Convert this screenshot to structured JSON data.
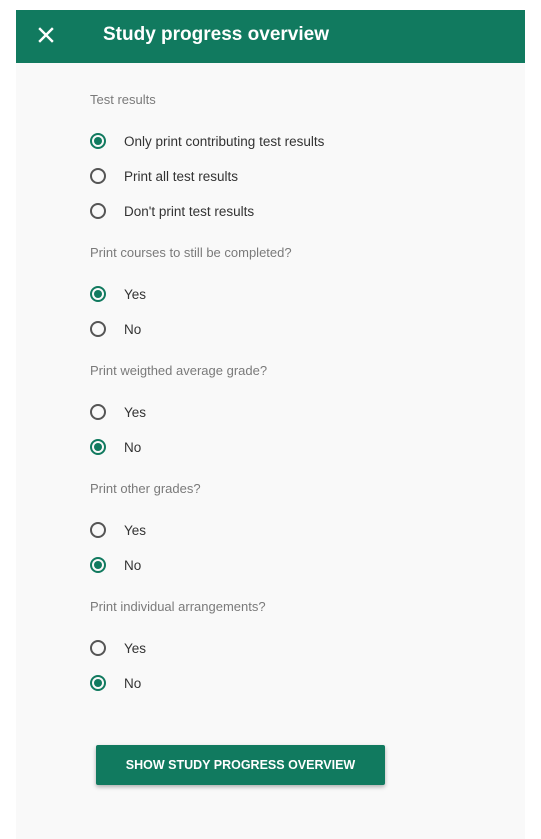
{
  "header": {
    "title": "Study progress overview",
    "close_icon": "close-icon"
  },
  "colors": {
    "primary": "#117a5f",
    "panel_background": "#f9f9f9",
    "label_text": "#7a7a7a"
  },
  "groups": [
    {
      "label": "Test results",
      "options": [
        {
          "label": "Only print contributing test results",
          "checked": true
        },
        {
          "label": "Print all test results",
          "checked": false
        },
        {
          "label": "Don't print test results",
          "checked": false
        }
      ]
    },
    {
      "label": "Print courses to still be completed?",
      "options": [
        {
          "label": "Yes",
          "checked": true
        },
        {
          "label": "No",
          "checked": false
        }
      ]
    },
    {
      "label": "Print weigthed average grade?",
      "options": [
        {
          "label": "Yes",
          "checked": false
        },
        {
          "label": "No",
          "checked": true
        }
      ]
    },
    {
      "label": "Print other grades?",
      "options": [
        {
          "label": "Yes",
          "checked": false
        },
        {
          "label": "No",
          "checked": true
        }
      ]
    },
    {
      "label": "Print individual arrangements?",
      "options": [
        {
          "label": "Yes",
          "checked": false
        },
        {
          "label": "No",
          "checked": true
        }
      ]
    }
  ],
  "submit_label": "SHOW STUDY PROGRESS OVERVIEW"
}
